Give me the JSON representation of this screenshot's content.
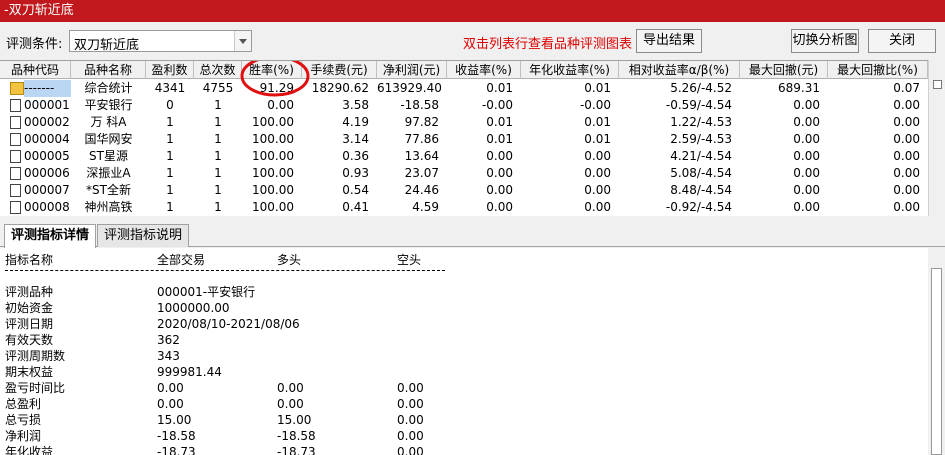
{
  "window": {
    "title": "-双刀斩近底"
  },
  "toolbar": {
    "condition_label": "评测条件:",
    "condition_value": "双刀斩近底",
    "hint": "双击列表行查看品种评测图表",
    "export_label": "导出结果",
    "switch_label": "切换分析图",
    "close_label": "关闭"
  },
  "table": {
    "columns": [
      "品种代码",
      "品种名称",
      "盈利数",
      "总次数",
      "胜率(%)",
      "手续费(元)",
      "净利润(元)",
      "收益率(%)",
      "年化收益率(%)",
      "相对收益率α/β(%)",
      "最大回撤(元)",
      "最大回撤比(%)"
    ],
    "rows": [
      {
        "icon": "folder-icon",
        "code": "-------",
        "name": "综合统计",
        "wins": "4341",
        "total": "4755",
        "winrate": "91.29",
        "fee": "18290.62",
        "profit": "613929.40",
        "ret": "0.01",
        "annual": "0.01",
        "rel": "5.26/-4.52",
        "maxdd": "689.31",
        "maxddr": "0.07"
      },
      {
        "icon": "doc-icon",
        "code": "000001",
        "name": "平安银行",
        "wins": "0",
        "total": "1",
        "winrate": "0.00",
        "fee": "3.58",
        "profit": "-18.58",
        "ret": "-0.00",
        "annual": "-0.00",
        "rel": "-0.59/-4.54",
        "maxdd": "0.00",
        "maxddr": "0.00"
      },
      {
        "icon": "doc-icon",
        "code": "000002",
        "name": "万 科A",
        "wins": "1",
        "total": "1",
        "winrate": "100.00",
        "fee": "4.19",
        "profit": "97.82",
        "ret": "0.01",
        "annual": "0.01",
        "rel": "1.22/-4.53",
        "maxdd": "0.00",
        "maxddr": "0.00"
      },
      {
        "icon": "doc-icon",
        "code": "000004",
        "name": "国华网安",
        "wins": "1",
        "total": "1",
        "winrate": "100.00",
        "fee": "3.14",
        "profit": "77.86",
        "ret": "0.01",
        "annual": "0.01",
        "rel": "2.59/-4.53",
        "maxdd": "0.00",
        "maxddr": "0.00"
      },
      {
        "icon": "doc-icon",
        "code": "000005",
        "name": "ST星源",
        "wins": "1",
        "total": "1",
        "winrate": "100.00",
        "fee": "0.36",
        "profit": "13.64",
        "ret": "0.00",
        "annual": "0.00",
        "rel": "4.21/-4.54",
        "maxdd": "0.00",
        "maxddr": "0.00"
      },
      {
        "icon": "doc-icon",
        "code": "000006",
        "name": "深振业A",
        "wins": "1",
        "total": "1",
        "winrate": "100.00",
        "fee": "0.93",
        "profit": "23.07",
        "ret": "0.00",
        "annual": "0.00",
        "rel": "5.08/-4.54",
        "maxdd": "0.00",
        "maxddr": "0.00"
      },
      {
        "icon": "doc-icon",
        "code": "000007",
        "name": "*ST全新",
        "wins": "1",
        "total": "1",
        "winrate": "100.00",
        "fee": "0.54",
        "profit": "24.46",
        "ret": "0.00",
        "annual": "0.00",
        "rel": "8.48/-4.54",
        "maxdd": "0.00",
        "maxddr": "0.00"
      },
      {
        "icon": "doc-icon",
        "code": "000008",
        "name": "神州高铁",
        "wins": "1",
        "total": "1",
        "winrate": "100.00",
        "fee": "0.41",
        "profit": "4.59",
        "ret": "0.00",
        "annual": "0.00",
        "rel": "-0.92/-4.54",
        "maxdd": "0.00",
        "maxddr": "0.00"
      }
    ]
  },
  "tabs": [
    "评测指标详情",
    "评测指标说明"
  ],
  "detail": {
    "header": [
      "指标名称",
      "全部交易",
      "多头",
      "空头"
    ],
    "lines": [
      [
        "评测品种",
        "000001-平安银行",
        "",
        ""
      ],
      [
        "初始资金",
        "1000000.00",
        "",
        ""
      ],
      [
        "评测日期",
        "2020/08/10-2021/08/06",
        "",
        ""
      ],
      [
        "有效天数",
        "362",
        "",
        ""
      ],
      [
        "评测周期数",
        "343",
        "",
        ""
      ],
      [
        "期末权益",
        "999981.44",
        "",
        ""
      ],
      [
        "盈亏时间比",
        "0.00",
        "0.00",
        "0.00"
      ],
      [
        "总盈利",
        "0.00",
        "0.00",
        "0.00"
      ],
      [
        "总亏损",
        "15.00",
        "15.00",
        "0.00"
      ],
      [
        "净利润",
        "-18.58",
        "-18.58",
        "0.00"
      ],
      [
        "年化收益",
        "-18.73",
        "-18.73",
        "0.00"
      ]
    ]
  },
  "colors": {
    "titlebar": "#c0181c",
    "hint": "#e00000",
    "selected": "#b9d7f2"
  }
}
